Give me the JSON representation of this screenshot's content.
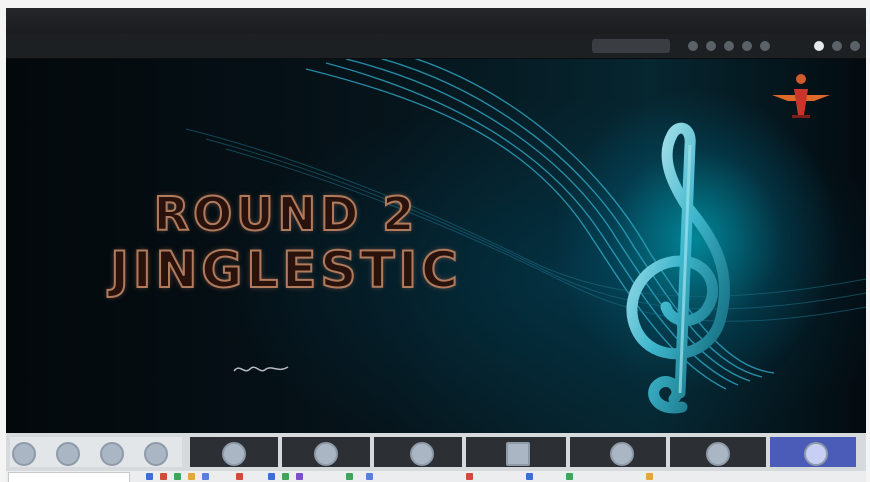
{
  "window": {
    "title": ""
  },
  "slide": {
    "title_line1": "ROUND 2",
    "title_line2": "JINGLESTIC",
    "icon": "treble-clef"
  },
  "participants": [
    {
      "name": "",
      "icon": "camera-off"
    },
    {
      "name": "",
      "icon": "camera-off"
    },
    {
      "name": "",
      "icon": "camera-off"
    },
    {
      "name": "",
      "icon": "camera-off"
    },
    {
      "name": "",
      "icon": "camera-off"
    },
    {
      "name": "",
      "icon": "camera-off"
    },
    {
      "name": "",
      "icon": "camera-off"
    },
    {
      "name": "",
      "icon": "camera-off"
    },
    {
      "name": "",
      "icon": "camera-off"
    },
    {
      "name": "",
      "icon": "camera-off"
    },
    {
      "name": "",
      "icon": "camera-off"
    }
  ],
  "colors": {
    "slide_bg": "#050b10",
    "title_stroke": "#b07a5c",
    "clef_glow": "#00d2e6"
  }
}
